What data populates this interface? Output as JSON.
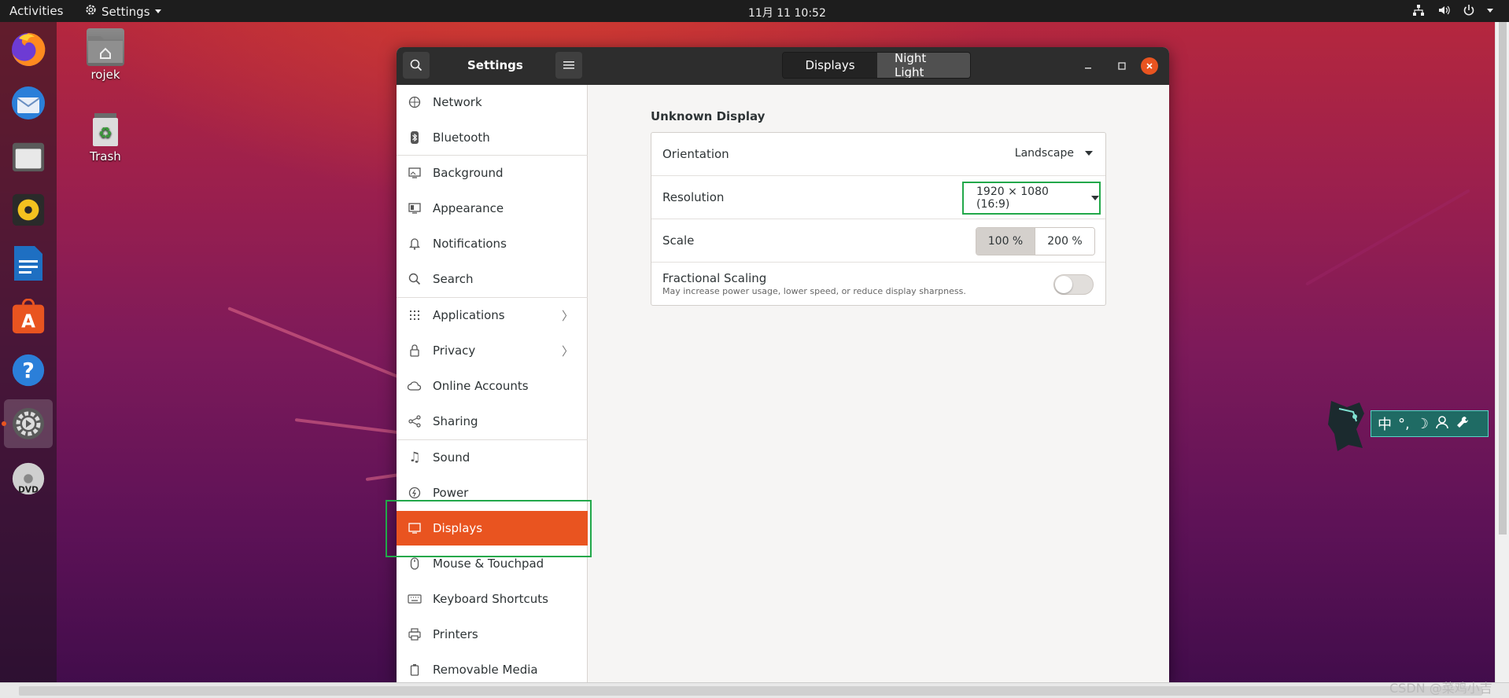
{
  "topbar": {
    "activities": "Activities",
    "app_menu": "Settings",
    "clock": "11月 11  10:52"
  },
  "desktop": {
    "icons": [
      {
        "label": "rojek",
        "icon": "home-folder-icon"
      },
      {
        "label": "Trash",
        "icon": "trash-icon"
      }
    ]
  },
  "dock": {
    "items": [
      "firefox-icon",
      "thunderbird-icon",
      "files-icon",
      "rhythmbox-icon",
      "writer-icon",
      "software-icon",
      "help-icon",
      "settings-icon",
      "dvd-icon"
    ]
  },
  "window": {
    "title": "Settings",
    "tabs": [
      {
        "label": "Displays",
        "active": true
      },
      {
        "label": "Night Light",
        "active": false
      }
    ],
    "controls": {
      "minimize": "–",
      "maximize": "□",
      "close": "×"
    }
  },
  "sidebar": {
    "items": [
      {
        "label": "Network",
        "icon": "network-icon"
      },
      {
        "label": "Bluetooth",
        "icon": "bluetooth-icon"
      },
      {
        "label": "Background",
        "icon": "background-icon"
      },
      {
        "label": "Appearance",
        "icon": "appearance-icon"
      },
      {
        "label": "Notifications",
        "icon": "bell-icon"
      },
      {
        "label": "Search",
        "icon": "search-icon"
      },
      {
        "label": "Applications",
        "icon": "grid-icon",
        "chevron": true
      },
      {
        "label": "Privacy",
        "icon": "lock-icon",
        "chevron": true
      },
      {
        "label": "Online Accounts",
        "icon": "cloud-icon"
      },
      {
        "label": "Sharing",
        "icon": "share-icon"
      },
      {
        "label": "Sound",
        "icon": "music-note-icon"
      },
      {
        "label": "Power",
        "icon": "power-icon"
      },
      {
        "label": "Displays",
        "icon": "display-icon",
        "selected": true
      },
      {
        "label": "Mouse & Touchpad",
        "icon": "mouse-icon"
      },
      {
        "label": "Keyboard Shortcuts",
        "icon": "keyboard-icon"
      },
      {
        "label": "Printers",
        "icon": "printer-icon"
      },
      {
        "label": "Removable Media",
        "icon": "removable-media-icon"
      }
    ]
  },
  "display": {
    "heading": "Unknown Display",
    "orientation": {
      "label": "Orientation",
      "value": "Landscape"
    },
    "resolution": {
      "label": "Resolution",
      "value": "1920 × 1080 (16:9)"
    },
    "scale": {
      "label": "Scale",
      "options": [
        "100 %",
        "200 %"
      ],
      "selected": "100 %"
    },
    "fractional": {
      "title": "Fractional Scaling",
      "subtitle": "May increase power usage, lower speed, or reduce display sharpness.",
      "enabled": false
    }
  },
  "ime_widget": {
    "items": [
      "中",
      "°,",
      "☽",
      "person-icon",
      "wrench-icon"
    ]
  },
  "watermark": "CSDN @菜鸡小吉",
  "colors": {
    "accent": "#e95420",
    "highlight": "#22a84a",
    "headerbar": "#2d2d2d"
  }
}
